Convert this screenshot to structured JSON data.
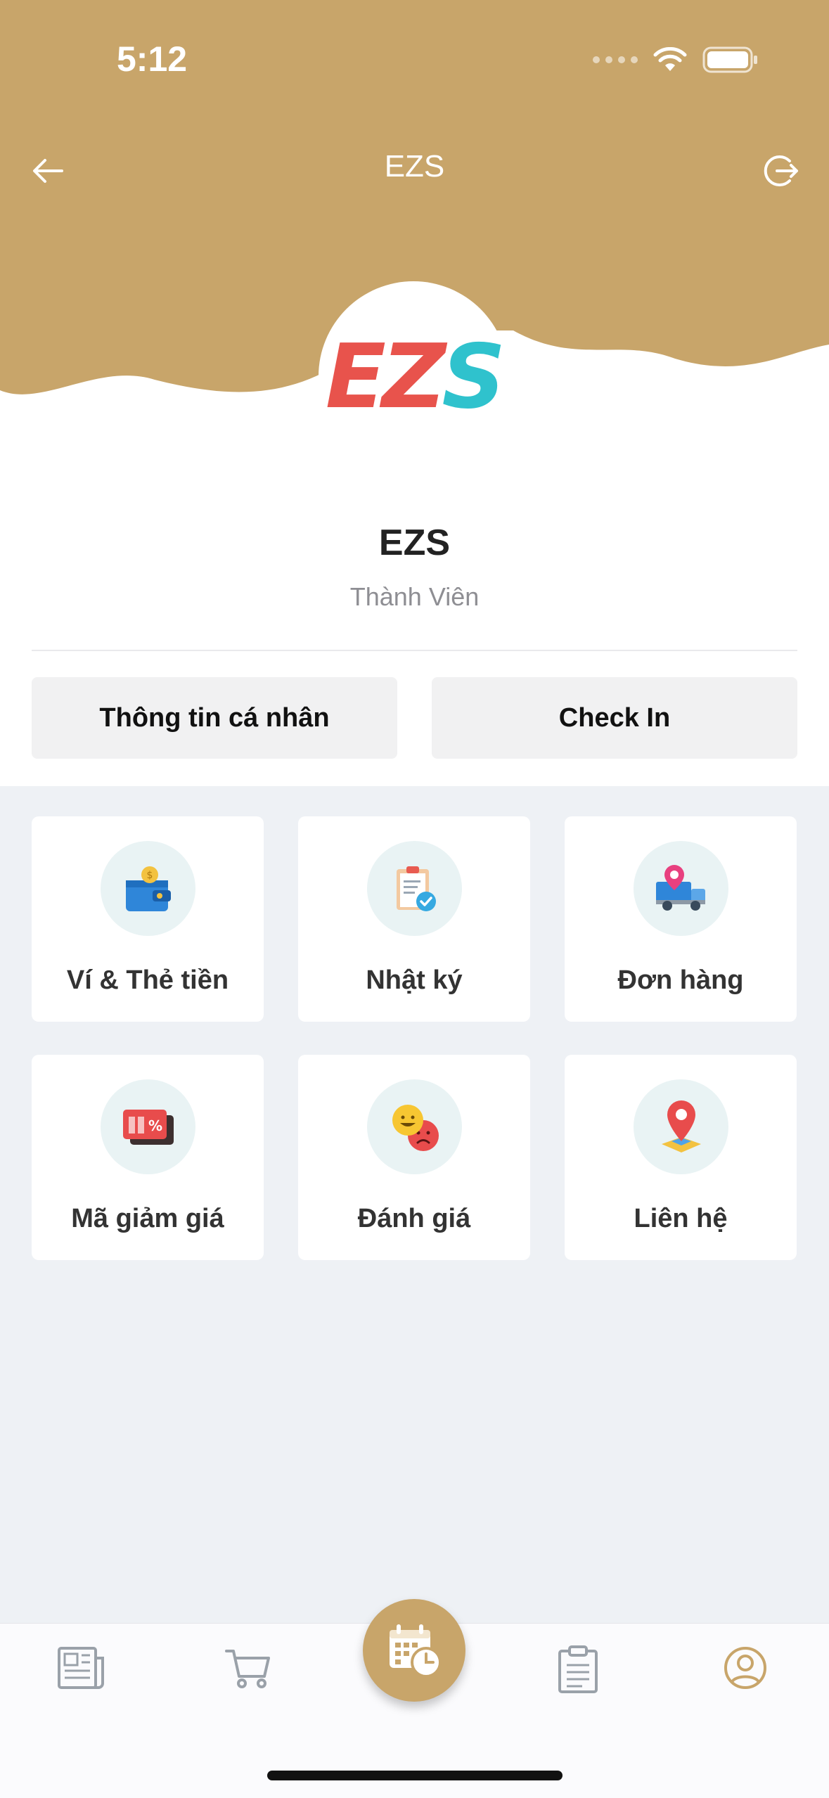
{
  "status": {
    "time": "5:12"
  },
  "nav": {
    "title": "EZS"
  },
  "logo": {
    "part1": "EZ",
    "part2": "S"
  },
  "profile": {
    "name": "EZS",
    "role": "Thành Viên"
  },
  "actions": {
    "personal_info": "Thông tin cá nhân",
    "check_in": "Check In"
  },
  "menu": [
    {
      "label": "Ví & Thẻ tiền",
      "icon": "wallet-icon"
    },
    {
      "label": "Nhật ký",
      "icon": "clipboard-check-icon"
    },
    {
      "label": "Đơn hàng",
      "icon": "delivery-truck-icon"
    },
    {
      "label": "Mã giảm giá",
      "icon": "gift-coupon-icon"
    },
    {
      "label": "Đánh giá",
      "icon": "emoji-rating-icon"
    },
    {
      "label": "Liên hệ",
      "icon": "map-pin-icon"
    }
  ],
  "tabbar": {
    "items": [
      "news-icon",
      "cart-icon",
      "calendar-clock-icon",
      "clipboard-icon",
      "profile-icon"
    ],
    "active": "profile-icon"
  },
  "colors": {
    "brand_gold": "#c8a56a",
    "logo_red": "#e8534c",
    "logo_teal": "#2fc2cd"
  }
}
